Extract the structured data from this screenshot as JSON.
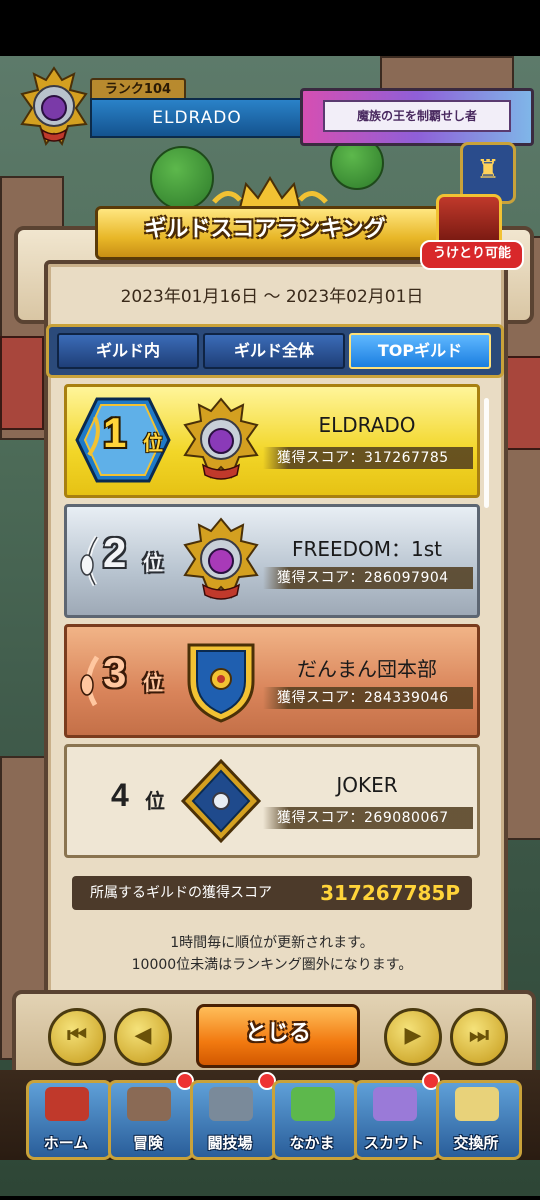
{
  "header": {
    "rank_label": "ランク104",
    "guild_name": "ELDRADO",
    "title_badge": "魔族の王を制覇せし者"
  },
  "banner": {
    "title": "ギルドスコアランキング",
    "receive_label": "うけとり可能"
  },
  "period": "2023年01月16日 〜 2023年02月01日",
  "tabs": [
    {
      "label": "ギルド内",
      "active": false
    },
    {
      "label": "ギルド全体",
      "active": false
    },
    {
      "label": "TOPギルド",
      "active": true
    }
  ],
  "ranking": [
    {
      "rank": "1",
      "suffix": "位",
      "name": "ELDRADO",
      "score_label": "獲得スコア：317267785"
    },
    {
      "rank": "2",
      "suffix": "位",
      "name": "FREEDOM：1st",
      "score_label": "獲得スコア：286097904"
    },
    {
      "rank": "3",
      "suffix": "位",
      "name": "だんまん団本部",
      "score_label": "獲得スコア：284339046"
    },
    {
      "rank": "4",
      "suffix": "位",
      "name": "JOKER",
      "score_label": "獲得スコア：269080067"
    }
  ],
  "own_score": {
    "label": "所属するギルドの獲得スコア",
    "value": "317267785P"
  },
  "notes": [
    "1時間毎に順位が更新されます。",
    "10000位未満はランキング圏外になります。"
  ],
  "close_label": "とじる",
  "nav": [
    {
      "label": "ホーム"
    },
    {
      "label": "冒険"
    },
    {
      "label": "闘技場"
    },
    {
      "label": "なかま"
    },
    {
      "label": "スカウト"
    },
    {
      "label": "交換所"
    }
  ],
  "colors": {
    "gold": "#f2d628",
    "silver": "#b8c4d0",
    "bronze": "#d9845a",
    "close_button": "#f27a10",
    "tab_active": "#1b7ee0"
  }
}
